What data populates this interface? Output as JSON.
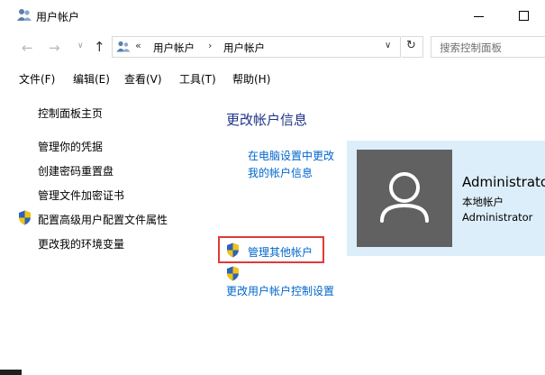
{
  "window": {
    "title": "用户帐户",
    "icon": "users-icon",
    "minimize": "minimize",
    "maximize": "maximize"
  },
  "nav": {
    "back_icon": "back-arrow-icon",
    "forward_icon": "forward-arrow-icon",
    "up_icon": "up-arrow-icon",
    "chevron_glyph": "«",
    "breadcrumb": [
      "用户帐户",
      "用户帐户"
    ],
    "separator": "›",
    "refresh_glyph": "↻",
    "search_placeholder": "搜索控制面板"
  },
  "menu": {
    "file": "文件(F)",
    "edit": "编辑(E)",
    "view": "查看(V)",
    "tools": "工具(T)",
    "help": "帮助(H)"
  },
  "sidebar": {
    "home": "控制面板主页",
    "items": [
      "管理你的凭据",
      "创建密码重置盘",
      "管理文件加密证书",
      "配置高级用户配置文件属性",
      "更改我的环境变量"
    ]
  },
  "main": {
    "title": "更改帐户信息",
    "links": {
      "pc_settings": "在电脑设置中更改我的帐户信息",
      "manage_other": "管理其他帐户",
      "uac": "更改用户帐户控制设置"
    }
  },
  "account": {
    "name": "Administrator",
    "type": "本地帐户",
    "group": "Administrator"
  },
  "colors": {
    "link": "#0066cc",
    "heading": "#1e3287",
    "card_bg": "#dceefa",
    "avatar_bg": "#616161",
    "highlight": "#e03a3a"
  }
}
